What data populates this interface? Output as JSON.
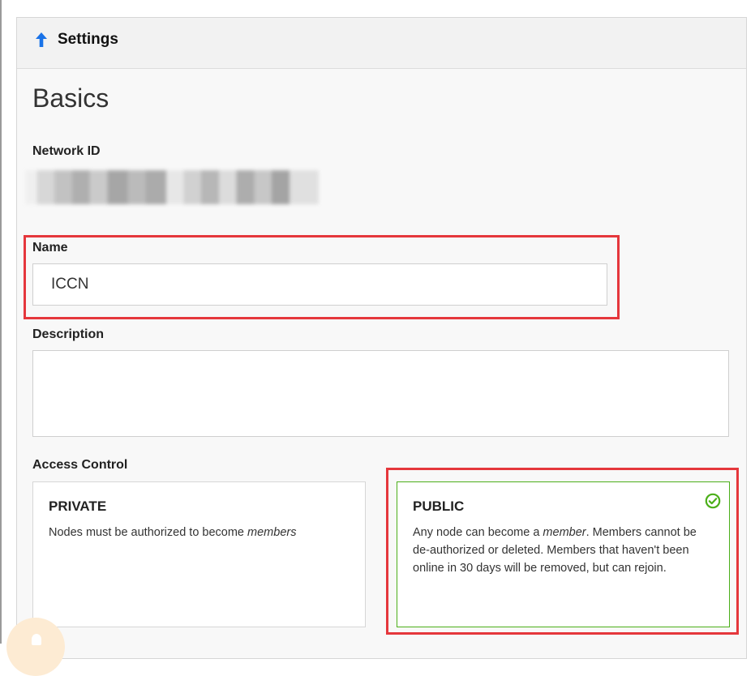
{
  "panel": {
    "title": "Settings",
    "section_title": "Basics"
  },
  "network_id": {
    "label": "Network ID",
    "value": ""
  },
  "name_field": {
    "label": "Name",
    "value": "ICCN"
  },
  "description_field": {
    "label": "Description",
    "value": ""
  },
  "access_control": {
    "label": "Access Control",
    "selected": "PUBLIC",
    "private": {
      "title": "PRIVATE",
      "desc_prefix": "Nodes must be authorized to become ",
      "desc_em": "members"
    },
    "public": {
      "title": "PUBLIC",
      "desc_prefix": "Any node can become a ",
      "desc_em": "member",
      "desc_rest_line1": ". Members cannot be",
      "desc_line2": "de-authorized or deleted. Members that haven't been",
      "desc_line3": "online in 30 days will be removed, but can rejoin."
    }
  },
  "icons": {
    "header": "arrow-up-icon",
    "selected": "check-circle-icon"
  },
  "colors": {
    "accent_blue": "#1a73e8",
    "selected_green": "#4caf1a",
    "annotation_red": "#e5373c"
  }
}
